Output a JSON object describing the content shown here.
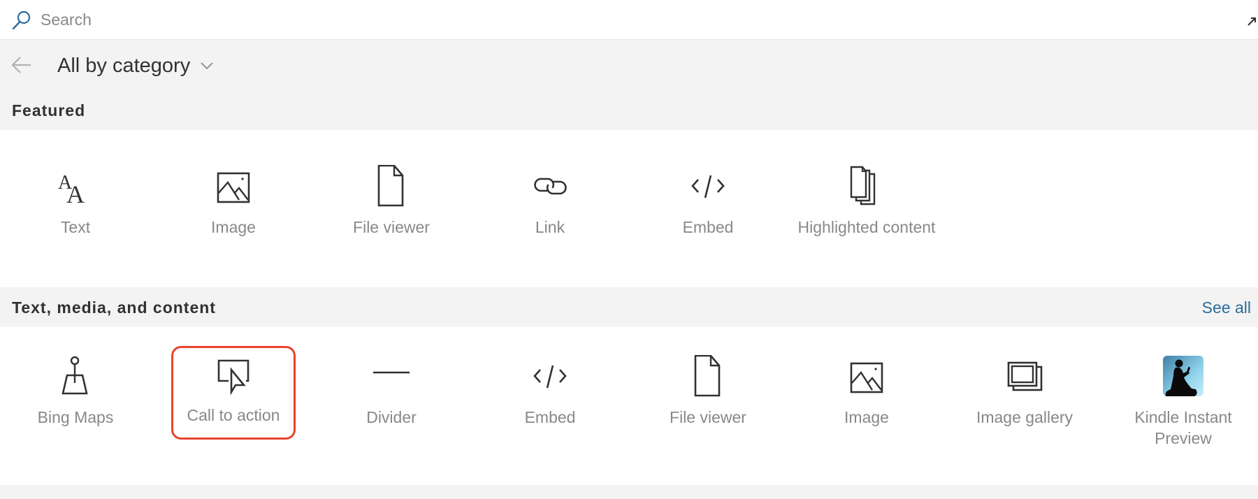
{
  "search": {
    "placeholder": "Search",
    "value": "",
    "icon": "search-icon"
  },
  "nav": {
    "back_icon": "arrow-left-icon",
    "category_label": "All by category",
    "dropdown_icon": "chevron-down-icon"
  },
  "colors": {
    "accent_link": "#2b6c9a",
    "highlight_border": "#e8452c",
    "search_icon": "#2b6c9a"
  },
  "sections": [
    {
      "title": "Featured",
      "see_all": null,
      "items": [
        {
          "label": "Text",
          "icon": "text-icon"
        },
        {
          "label": "Image",
          "icon": "image-icon"
        },
        {
          "label": "File viewer",
          "icon": "file-icon"
        },
        {
          "label": "Link",
          "icon": "link-icon"
        },
        {
          "label": "Embed",
          "icon": "code-icon"
        },
        {
          "label": "Highlighted content",
          "label_lines": [
            "Highlighted",
            "content"
          ],
          "icon": "stacked-documents-icon"
        }
      ]
    },
    {
      "title": "Text, media, and content",
      "see_all": "See all",
      "items": [
        {
          "label": "Bing Maps",
          "icon": "map-pin-icon"
        },
        {
          "label": "Call to action",
          "icon": "cursor-click-icon",
          "highlighted": true
        },
        {
          "label": "Divider",
          "icon": "divider-icon"
        },
        {
          "label": "Embed",
          "icon": "code-icon"
        },
        {
          "label": "File viewer",
          "icon": "file-icon"
        },
        {
          "label": "Image",
          "icon": "image-icon"
        },
        {
          "label": "Image gallery",
          "icon": "image-gallery-icon"
        },
        {
          "label": "Kindle Instant Preview",
          "label_lines": [
            "Kindle Instant",
            "Preview"
          ],
          "icon": "kindle-reader-icon"
        }
      ]
    }
  ]
}
